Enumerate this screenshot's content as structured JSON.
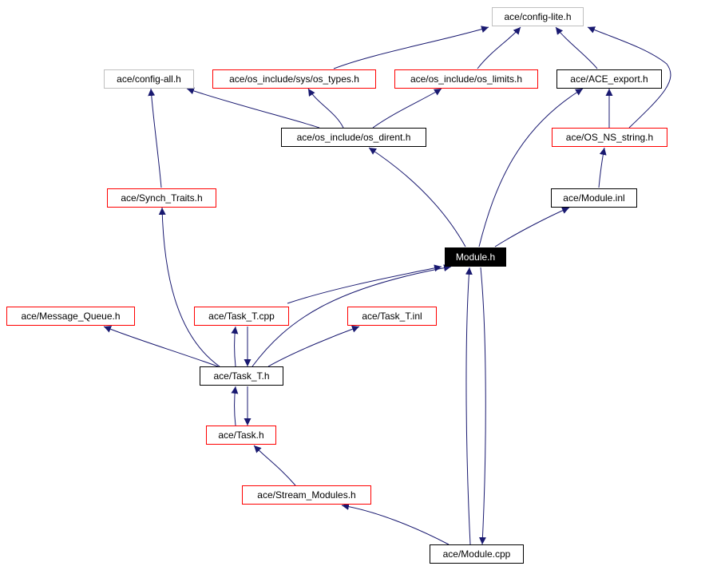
{
  "nodes": {
    "config_lite": {
      "label": "ace/config-lite.h",
      "style": "gray"
    },
    "config_all": {
      "label": "ace/config-all.h",
      "style": "gray"
    },
    "os_types": {
      "label": "ace/os_include/sys/os_types.h",
      "style": "red"
    },
    "os_limits": {
      "label": "ace/os_include/os_limits.h",
      "style": "red"
    },
    "ace_export": {
      "label": "ace/ACE_export.h",
      "style": "black"
    },
    "os_dirent": {
      "label": "ace/os_include/os_dirent.h",
      "style": "black"
    },
    "os_ns_string": {
      "label": "ace/OS_NS_string.h",
      "style": "red"
    },
    "synch_traits": {
      "label": "ace/Synch_Traits.h",
      "style": "red"
    },
    "module_inl": {
      "label": "ace/Module.inl",
      "style": "black"
    },
    "module_h": {
      "label": "Module.h",
      "style": "current"
    },
    "message_queue": {
      "label": "ace/Message_Queue.h",
      "style": "red"
    },
    "task_t_cpp": {
      "label": "ace/Task_T.cpp",
      "style": "red"
    },
    "task_t_inl": {
      "label": "ace/Task_T.inl",
      "style": "red"
    },
    "task_t_h": {
      "label": "ace/Task_T.h",
      "style": "black"
    },
    "task_h": {
      "label": "ace/Task.h",
      "style": "red"
    },
    "stream_modules": {
      "label": "ace/Stream_Modules.h",
      "style": "red"
    },
    "module_cpp": {
      "label": "ace/Module.cpp",
      "style": "black"
    }
  },
  "edges": [
    {
      "from": "os_types",
      "to": "config_lite"
    },
    {
      "from": "os_limits",
      "to": "config_lite"
    },
    {
      "from": "ace_export",
      "to": "config_lite"
    },
    {
      "from": "os_ns_string",
      "to": "config_lite"
    },
    {
      "from": "os_dirent",
      "to": "config_all"
    },
    {
      "from": "os_dirent",
      "to": "os_types"
    },
    {
      "from": "os_dirent",
      "to": "os_limits"
    },
    {
      "from": "os_ns_string",
      "to": "ace_export"
    },
    {
      "from": "module_inl",
      "to": "os_ns_string"
    },
    {
      "from": "module_h",
      "to": "os_dirent"
    },
    {
      "from": "module_h",
      "to": "ace_export"
    },
    {
      "from": "module_h",
      "to": "module_inl"
    },
    {
      "from": "synch_traits",
      "to": "config_all"
    },
    {
      "from": "task_t_h",
      "to": "synch_traits"
    },
    {
      "from": "task_t_cpp",
      "to": "module_h"
    },
    {
      "from": "task_t_h",
      "to": "module_h"
    },
    {
      "from": "task_t_h",
      "to": "message_queue"
    },
    {
      "from": "task_t_h",
      "to": "task_t_cpp"
    },
    {
      "from": "task_t_cpp",
      "to": "task_t_h"
    },
    {
      "from": "task_t_h",
      "to": "task_t_inl"
    },
    {
      "from": "task_h",
      "to": "task_t_h"
    },
    {
      "from": "task_t_h",
      "to": "task_h"
    },
    {
      "from": "stream_modules",
      "to": "task_h"
    },
    {
      "from": "module_cpp",
      "to": "stream_modules"
    },
    {
      "from": "module_cpp",
      "to": "module_h"
    },
    {
      "from": "module_h",
      "to": "module_cpp"
    }
  ],
  "colors": {
    "edge": "#191970",
    "red_border": "#ff0000",
    "gray_border": "#bfbfbf",
    "current_fill": "#000000"
  }
}
